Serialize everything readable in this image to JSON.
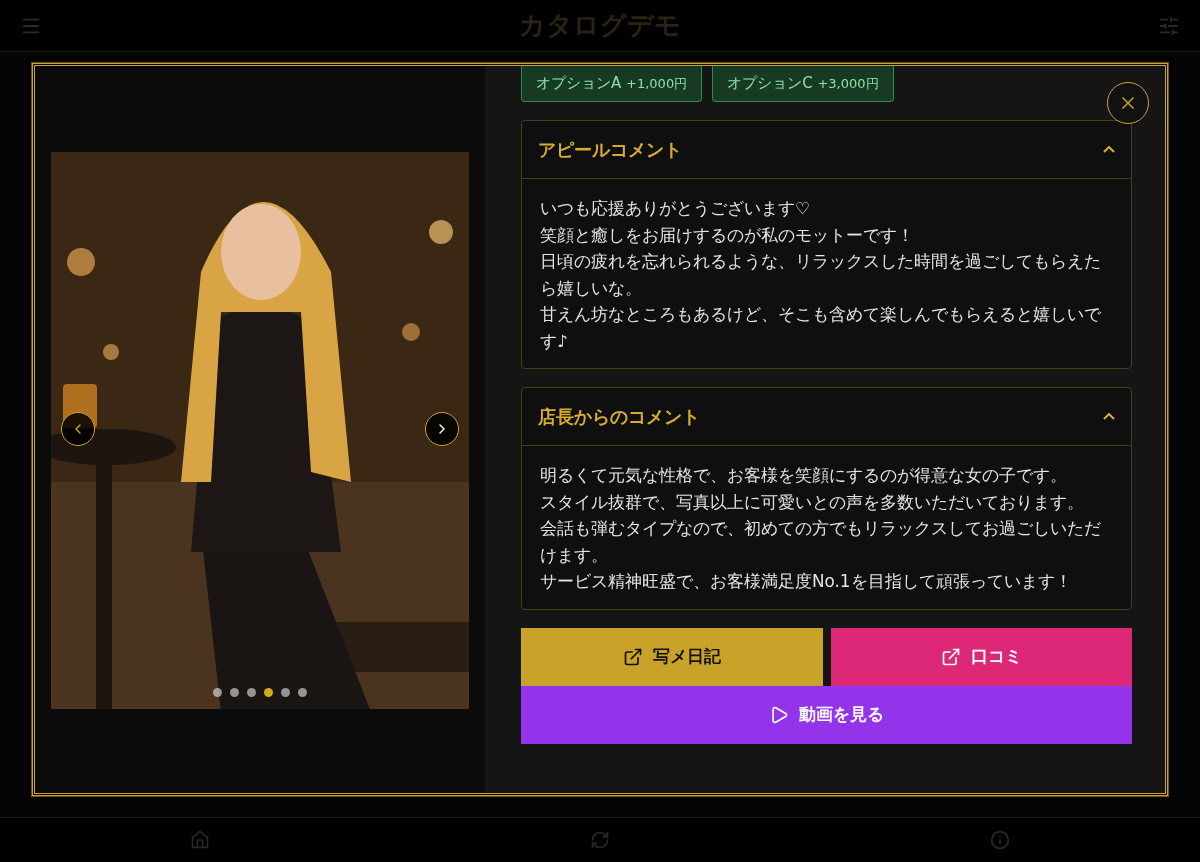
{
  "header": {
    "title": "カタログデモ"
  },
  "modal": {
    "options": [
      {
        "name": "オプションA",
        "price": "+1,000円"
      },
      {
        "name": "オプションC",
        "price": "+3,000円"
      }
    ],
    "gallery": {
      "dots": [
        {
          "selected": false
        },
        {
          "selected": false
        },
        {
          "selected": false
        },
        {
          "selected": true
        },
        {
          "selected": false
        },
        {
          "selected": false
        }
      ]
    },
    "sections": [
      {
        "title": "アピールコメント",
        "expanded": true,
        "lines": [
          "いつも応援ありがとうございます♡",
          "笑顔と癒しをお届けするのが私のモットーです！",
          "日頃の疲れを忘れられるような、リラックスした時間を過ごしてもらえたら嬉しいな。",
          "甘えん坊なところもあるけど、そこも含めて楽しんでもらえると嬉しいです♪"
        ]
      },
      {
        "title": "店長からのコメント",
        "expanded": true,
        "lines": [
          "明るくて元気な性格で、お客様を笑顔にするのが得意な女の子です。",
          "スタイル抜群で、写真以上に可愛いとの声を多数いただいております。",
          "会話も弾むタイプなので、初めての方でもリラックスしてお過ごしいただけます。",
          "サービス精神旺盛で、お客様満足度No.1を目指して頑張っています！"
        ]
      }
    ],
    "buttons": [
      {
        "label": "写メ日記",
        "kind": "external",
        "color": "#c9a22a"
      },
      {
        "label": "口コミ",
        "kind": "external",
        "color": "#dc2877"
      },
      {
        "label": "動画を見る",
        "kind": "play",
        "color": "#9333ea"
      }
    ]
  }
}
